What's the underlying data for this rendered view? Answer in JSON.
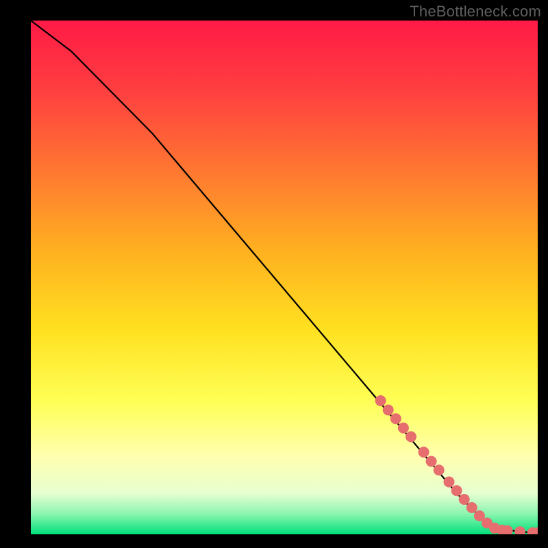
{
  "watermark": "TheBottleneck.com",
  "chart_data": {
    "type": "line",
    "title": "",
    "xlabel": "",
    "ylabel": "",
    "xlim": [
      0,
      100
    ],
    "ylim": [
      0,
      100
    ],
    "grid": false,
    "legend": false,
    "series": [
      {
        "name": "curve",
        "color": "#000000",
        "x": [
          0,
          4,
          8,
          12,
          16,
          20,
          24,
          30,
          36,
          42,
          48,
          54,
          60,
          66,
          72,
          78,
          84,
          88,
          90,
          92,
          94,
          96,
          98,
          100
        ],
        "y": [
          100,
          97,
          94,
          90,
          86,
          82,
          78,
          71,
          64,
          57,
          50,
          43,
          36,
          29,
          22,
          15,
          8,
          4,
          2,
          1.2,
          0.8,
          0.6,
          0.4,
          0.3
        ]
      }
    ],
    "markers": {
      "name": "highlighted-points",
      "color": "#e66e6e",
      "radius": 8,
      "points": [
        {
          "x": 69,
          "y": 26.0
        },
        {
          "x": 70.5,
          "y": 24.2
        },
        {
          "x": 72,
          "y": 22.5
        },
        {
          "x": 73.5,
          "y": 20.7
        },
        {
          "x": 75,
          "y": 19.0
        },
        {
          "x": 77.5,
          "y": 16.0
        },
        {
          "x": 79,
          "y": 14.2
        },
        {
          "x": 80.5,
          "y": 12.5
        },
        {
          "x": 82.5,
          "y": 10.2
        },
        {
          "x": 84,
          "y": 8.5
        },
        {
          "x": 85.5,
          "y": 6.8
        },
        {
          "x": 87,
          "y": 5.2
        },
        {
          "x": 88.5,
          "y": 3.6
        },
        {
          "x": 90,
          "y": 2.2
        },
        {
          "x": 91.5,
          "y": 1.2
        },
        {
          "x": 93,
          "y": 0.8
        },
        {
          "x": 94,
          "y": 0.7
        },
        {
          "x": 96.5,
          "y": 0.5
        },
        {
          "x": 99,
          "y": 0.3
        },
        {
          "x": 100,
          "y": 0.3
        }
      ]
    }
  }
}
